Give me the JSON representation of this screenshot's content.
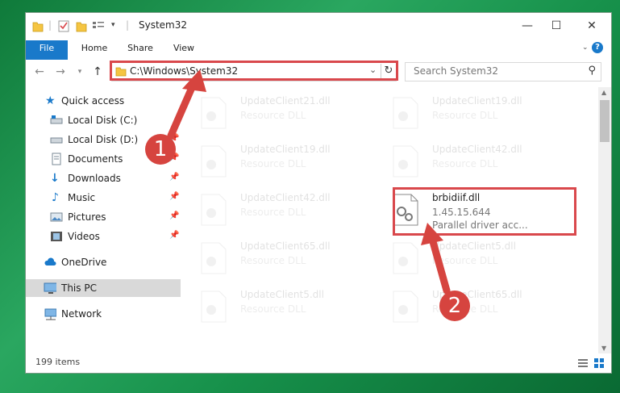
{
  "window": {
    "title": "System32"
  },
  "ribbon": {
    "tabs": [
      "File",
      "Home",
      "Share",
      "View"
    ],
    "help_label": "?"
  },
  "address": {
    "path": "C:\\Windows\\System32",
    "search_placeholder": "Search System32"
  },
  "navigation": {
    "items": [
      {
        "label": "Quick access",
        "icon": "star-icon"
      },
      {
        "label": "Local Disk (C:)",
        "icon": "drive-icon"
      },
      {
        "label": "Local Disk (D:)",
        "icon": "drive-icon"
      },
      {
        "label": "Documents",
        "icon": "documents-icon"
      },
      {
        "label": "Downloads",
        "icon": "download-icon"
      },
      {
        "label": "Music",
        "icon": "music-icon"
      },
      {
        "label": "Pictures",
        "icon": "pictures-icon"
      },
      {
        "label": "Videos",
        "icon": "videos-icon"
      },
      {
        "label": "OneDrive",
        "icon": "cloud-icon"
      },
      {
        "label": "This PC",
        "icon": "computer-icon"
      },
      {
        "label": "Network",
        "icon": "network-icon"
      }
    ]
  },
  "files": [
    {
      "name": "UpdateClient21.dll",
      "desc": "Resource DLL"
    },
    {
      "name": "UpdateClient19.dll",
      "desc": "Resource DLL"
    },
    {
      "name": "UpdateClient19.dll",
      "desc": "Resource DLL"
    },
    {
      "name": "UpdateClient42.dll",
      "desc": "Resource DLL"
    },
    {
      "name": "UpdateClient42.dll",
      "desc": "Resource DLL"
    },
    {
      "name": "UpdateClient65.dll",
      "desc": "Resource DLL"
    },
    {
      "name": "UpdateClient5.dll",
      "desc": "Resource DLL"
    },
    {
      "name": "UpdateClient5.dll",
      "desc": "Resource DLL"
    },
    {
      "name": "UpdateClient65.dll",
      "desc": "Resource DLL"
    }
  ],
  "highlighted_file": {
    "name": "brbidiif.dll",
    "version": "1.45.15.644",
    "desc": "Parallel driver acc..."
  },
  "status": {
    "item_count": "199 items"
  },
  "callouts": {
    "first": "1",
    "second": "2"
  },
  "colors": {
    "accent": "#1979ca",
    "highlight": "#d9484c",
    "desktop": "#1f9a53"
  }
}
